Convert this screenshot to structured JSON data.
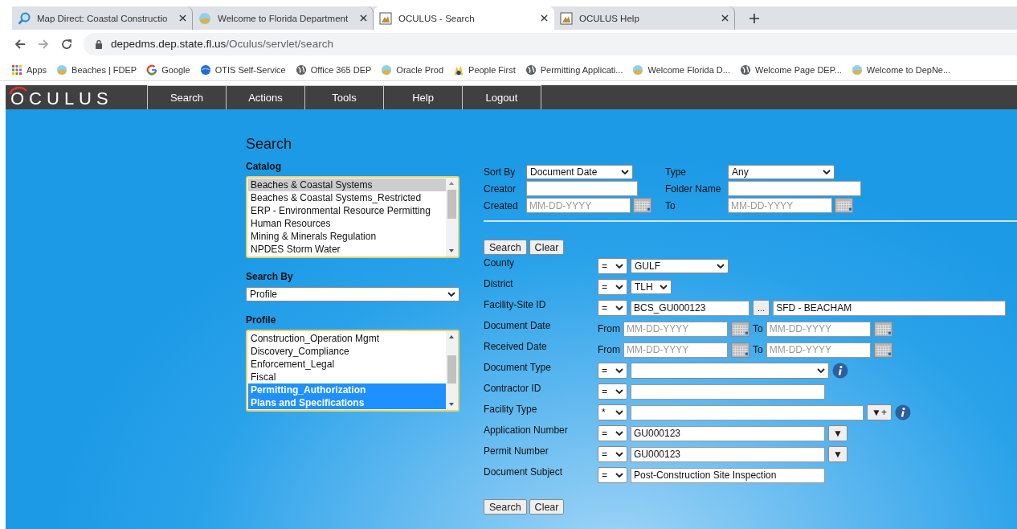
{
  "browser": {
    "tabs": [
      {
        "title": "Map Direct: Coastal Constructio",
        "kind": "magnifier",
        "selected": false
      },
      {
        "title": "Welcome to Florida Department",
        "kind": "beach",
        "selected": false
      },
      {
        "title": "OCULUS - Search",
        "kind": "oculus",
        "selected": true
      },
      {
        "title": "OCULUS Help",
        "kind": "oculus",
        "selected": false
      }
    ],
    "address": {
      "host": "depedms.dep.state.fl.us",
      "path": "/Oculus/servlet/search"
    },
    "bookmarks": [
      {
        "label": "Apps",
        "kind": "apps"
      },
      {
        "label": "Beaches | FDEP",
        "kind": "beach"
      },
      {
        "label": "Google",
        "kind": "google"
      },
      {
        "label": "OTIS Self-Service",
        "kind": "otis"
      },
      {
        "label": "Office 365 DEP",
        "kind": "globe"
      },
      {
        "label": "Oracle Prod",
        "kind": "beach"
      },
      {
        "label": "People First",
        "kind": "people"
      },
      {
        "label": "Permitting Applicati...",
        "kind": "globe"
      },
      {
        "label": "Welcome Florida D...",
        "kind": "beach"
      },
      {
        "label": "Welcome Page DEP...",
        "kind": "globe"
      },
      {
        "label": "Welcome to DepNe...",
        "kind": "beach"
      }
    ]
  },
  "app": {
    "logo": "OCULUS",
    "menu": [
      "Search",
      "Actions",
      "Tools",
      "Help",
      "Logout"
    ]
  },
  "search": {
    "title": "Search",
    "catalog": {
      "label": "Catalog",
      "items": [
        {
          "text": "Beaches & Coastal Systems",
          "selected": true
        },
        {
          "text": "Beaches & Coastal Systems_Restricted",
          "selected": false
        },
        {
          "text": "ERP - Environmental Resource Permitting",
          "selected": false
        },
        {
          "text": "Human Resources",
          "selected": false
        },
        {
          "text": "Mining & Minerals Regulation",
          "selected": false
        },
        {
          "text": "NPDES Storm Water",
          "selected": false
        }
      ]
    },
    "search_by": {
      "label": "Search By",
      "value": "Profile"
    },
    "profile": {
      "label": "Profile",
      "items": [
        {
          "text": "Construction_Operation Mgmt",
          "selected": false
        },
        {
          "text": "Discovery_Compliance",
          "selected": false
        },
        {
          "text": "Enforcement_Legal",
          "selected": false
        },
        {
          "text": "Fiscal",
          "selected": false
        },
        {
          "text": "Permitting_Authorization",
          "selected": true
        },
        {
          "text": "Plans and Specifications",
          "selected": true
        }
      ]
    }
  },
  "options": {
    "sort_by": {
      "label": "Sort By",
      "value": "Document Date"
    },
    "type": {
      "label": "Type",
      "value": "Any"
    },
    "creator": {
      "label": "Creator"
    },
    "folder_name": {
      "label": "Folder Name"
    },
    "created": {
      "label": "Created",
      "placeholder": "MM-DD-YYYY"
    },
    "to": {
      "label": "To",
      "placeholder": "MM-DD-YYYY"
    }
  },
  "top_buttons": [
    "Search",
    "Clear"
  ],
  "criteria": [
    {
      "label": "County",
      "kind": "select",
      "operator": "=",
      "value": "GULF"
    },
    {
      "label": "District",
      "kind": "select",
      "operator": "=",
      "value": "TLH"
    },
    {
      "label": "Facility-Site ID",
      "kind": "lookup",
      "operator": "=",
      "value": "BCS_GU000123",
      "button": "...",
      "name": "SFD - BEACHAM"
    },
    {
      "label": "Document Date",
      "kind": "daterange",
      "from": "From",
      "from_placeholder": "MM-DD-YYYY",
      "to": "To",
      "to_placeholder": "MM-DD-YYYY"
    },
    {
      "label": "Received Date",
      "kind": "daterange",
      "from": "From",
      "from_placeholder": "MM-DD-YYYY",
      "to": "To",
      "to_placeholder": "MM-DD-YYYY"
    },
    {
      "label": "Document Type",
      "kind": "select_info",
      "operator": "="
    },
    {
      "label": "Contractor ID",
      "kind": "text",
      "operator": "="
    },
    {
      "label": "Facility Type",
      "kind": "multi",
      "operator": "*",
      "button": "▼+"
    },
    {
      "label": "Application Number",
      "kind": "picker",
      "operator": "=",
      "value": "GU000123",
      "button": "▼"
    },
    {
      "label": "Permit Number",
      "kind": "picker",
      "operator": "=",
      "value": "GU000123",
      "button": "▼"
    },
    {
      "label": "Document Subject",
      "kind": "text",
      "operator": "=",
      "value": "Post-Construction Site Inspection"
    }
  ],
  "bottom_buttons": [
    "Search",
    "Clear"
  ]
}
